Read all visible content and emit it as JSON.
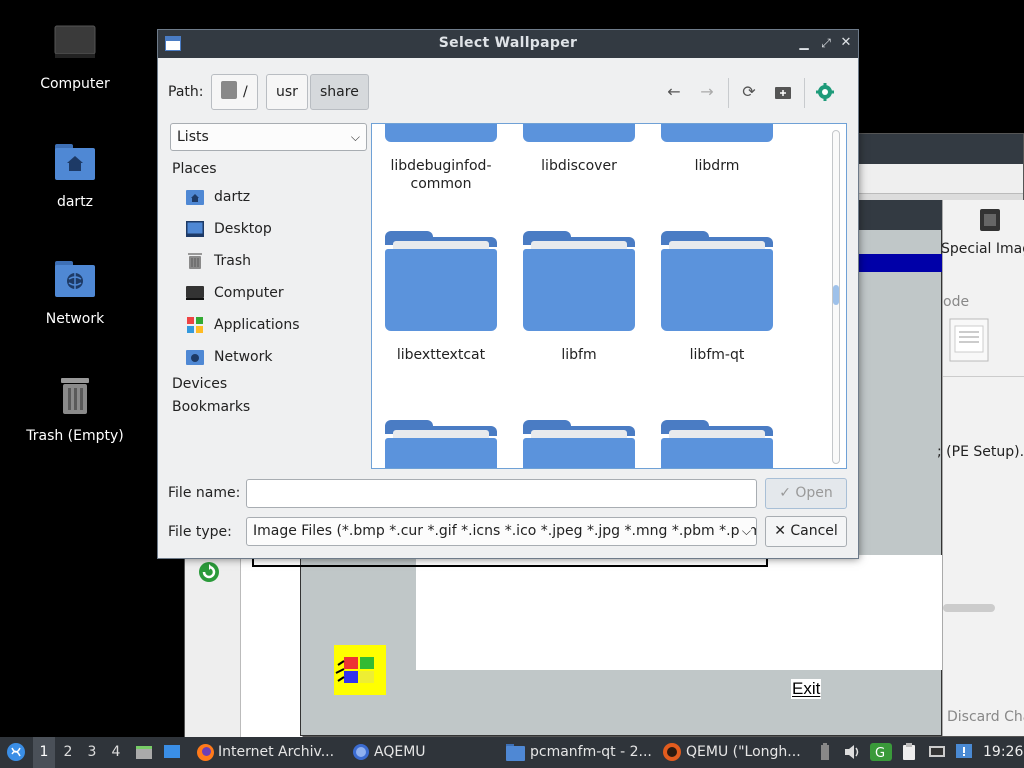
{
  "desktop": {
    "icons": [
      {
        "label": "Computer",
        "icon": "computer-icon"
      },
      {
        "label": "dartz",
        "icon": "home-folder-icon"
      },
      {
        "label": "Network",
        "icon": "network-folder-icon"
      },
      {
        "label": "Trash (Empty)",
        "icon": "trash-icon"
      }
    ]
  },
  "background": {
    "exit_label": "Exit",
    "special_image": "Special Imag",
    "mode_text": "ode",
    "pe_setup": "; (PE Setup).",
    "discard": "Discard Cha"
  },
  "dialog": {
    "title": "Select Wallpaper",
    "path_label": "Path:",
    "breadcrumbs": [
      "/",
      "usr",
      "share"
    ],
    "view_mode": "Lists",
    "sidebar": {
      "places_header": "Places",
      "places": [
        {
          "label": "dartz",
          "icon": "home-folder-icon"
        },
        {
          "label": "Desktop",
          "icon": "desktop-icon"
        },
        {
          "label": "Trash",
          "icon": "trash-icon"
        },
        {
          "label": "Computer",
          "icon": "computer-icon"
        },
        {
          "label": "Applications",
          "icon": "applications-icon"
        },
        {
          "label": "Network",
          "icon": "network-folder-icon"
        }
      ],
      "devices_header": "Devices",
      "bookmarks_header": "Bookmarks"
    },
    "files": {
      "row1": [
        "libdebuginfod-\ncommon",
        "libdiscover",
        "libdrm"
      ],
      "row2": [
        "libexttextcat",
        "libfm",
        "libfm-qt"
      ]
    },
    "file_name_label": "File name:",
    "file_name_value": "",
    "open_label": "Open",
    "file_type_label": "File type:",
    "file_type_value": "Image Files (*.bmp *.cur *.gif *.icns *.ico *.jpeg *.jpg *.mng *.pbm *.pgm",
    "cancel_label": "Cancel"
  },
  "taskbar": {
    "desktops": [
      "1",
      "2",
      "3",
      "4"
    ],
    "tasks": [
      {
        "label": "Internet Archiv...",
        "icon": "firefox-icon"
      },
      {
        "label": "AQEMU",
        "icon": "aqemu-icon"
      },
      {
        "label": "pcmanfm-qt - 2...",
        "icon": "folder-icon"
      },
      {
        "label": "QEMU (\"Longh...",
        "icon": "qemu-icon"
      }
    ],
    "clock": "19:26"
  },
  "colors": {
    "titlebar": "#333a42",
    "folder": "#5b93dc",
    "accent": "#6fa1d6",
    "taskbar": "#2f343a"
  }
}
